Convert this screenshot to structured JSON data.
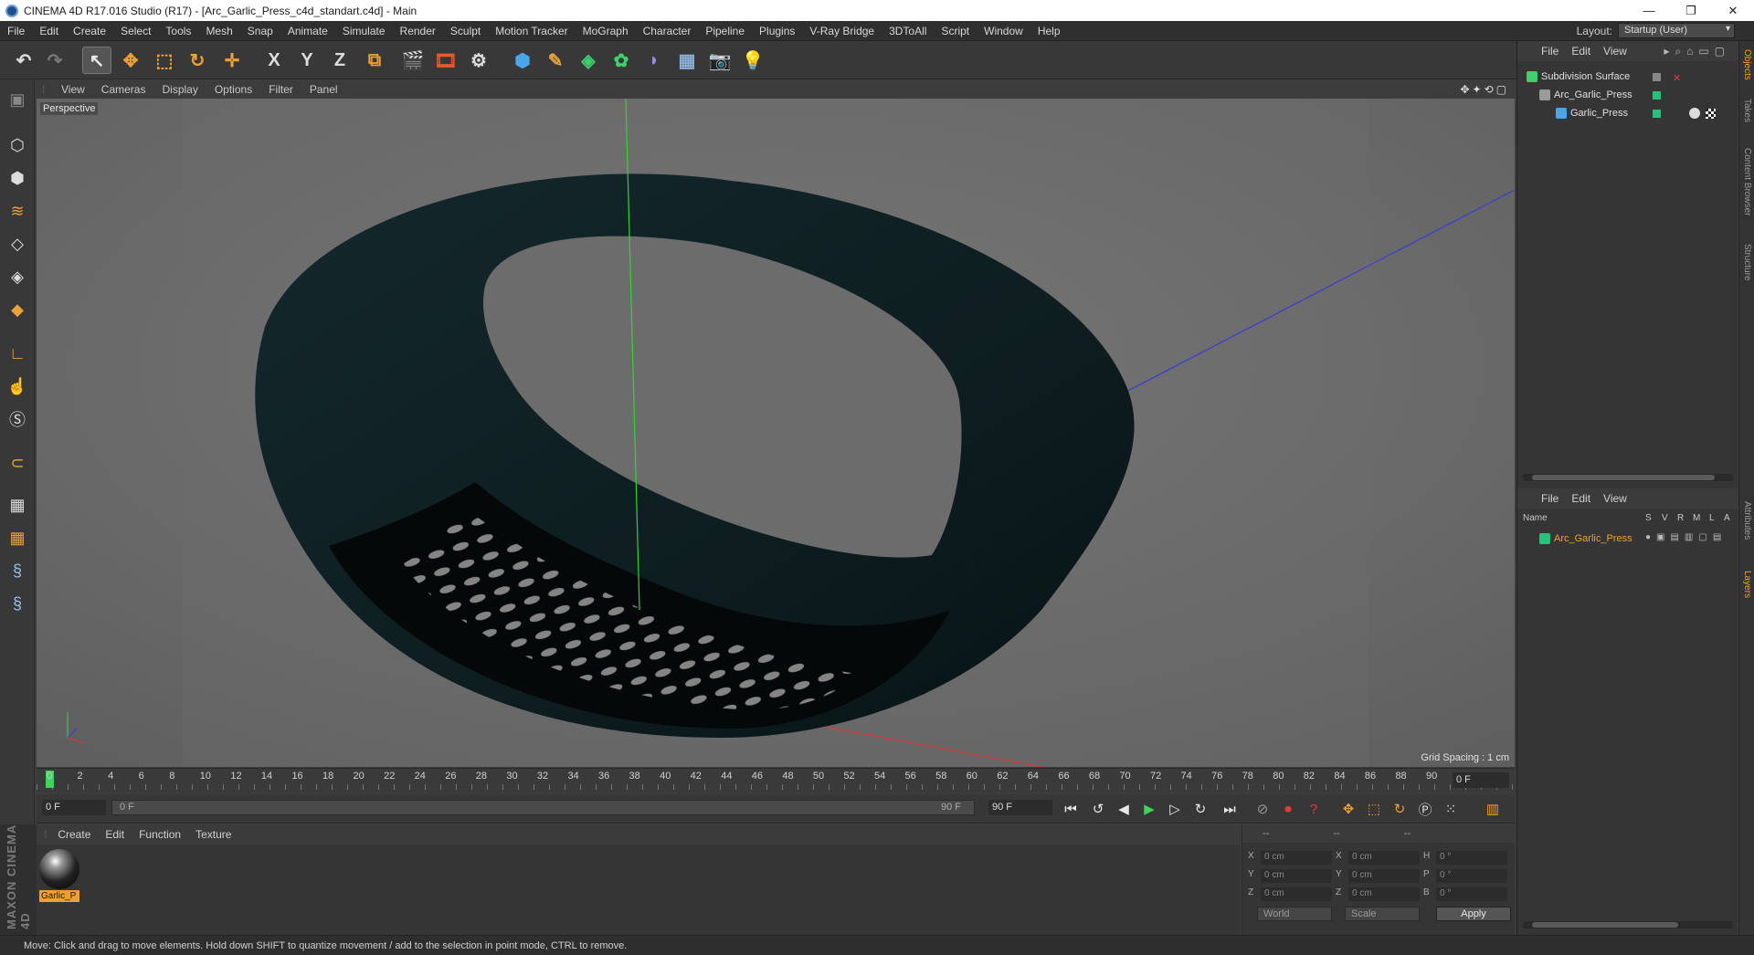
{
  "window": {
    "title": "CINEMA 4D R17.016 Studio (R17) - [Arc_Garlic_Press_c4d_standart.c4d] - Main",
    "controls": [
      "—",
      "❐",
      "✕"
    ]
  },
  "menu": [
    "File",
    "Edit",
    "Create",
    "Select",
    "Tools",
    "Mesh",
    "Snap",
    "Animate",
    "Simulate",
    "Render",
    "Sculpt",
    "Motion Tracker",
    "MoGraph",
    "Character",
    "Pipeline",
    "Plugins",
    "V-Ray Bridge",
    "3DToAll",
    "Script",
    "Window",
    "Help"
  ],
  "layout": {
    "label": "Layout:",
    "value": "Startup (User)"
  },
  "toolbar_icons": [
    "undo-icon",
    "redo-icon",
    "select-arrow-icon",
    "move-icon",
    "scale-icon",
    "rotate-icon",
    "live-select-icon",
    "x-axis-icon",
    "y-axis-icon",
    "z-axis-icon",
    "coordinate-system-icon",
    "render-view-icon",
    "render-picture-viewer-icon",
    "render-settings-icon",
    "cube-icon",
    "pen-icon",
    "subdivision-icon",
    "array-icon",
    "deformer-icon",
    "floor-icon",
    "camera-icon",
    "light-icon"
  ],
  "axis_labels": {
    "x": "X",
    "y": "Y",
    "z": "Z"
  },
  "viewport": {
    "menu": [
      "View",
      "Cameras",
      "Display",
      "Options",
      "Filter",
      "Panel"
    ],
    "label": "Perspective",
    "grid_spacing": "Grid Spacing : 1 cm"
  },
  "timeline": {
    "ticks": [
      "0",
      "2",
      "4",
      "6",
      "8",
      "10",
      "12",
      "14",
      "16",
      "18",
      "20",
      "22",
      "24",
      "26",
      "28",
      "30",
      "32",
      "34",
      "36",
      "38",
      "40",
      "42",
      "44",
      "46",
      "48",
      "50",
      "52",
      "54",
      "56",
      "58",
      "60",
      "62",
      "64",
      "66",
      "68",
      "70",
      "72",
      "74",
      "76",
      "78",
      "80",
      "82",
      "84",
      "86",
      "88",
      "90"
    ],
    "current_frame": "0 F"
  },
  "transport": {
    "start_frame": "0 F",
    "range_start": "0 F",
    "range_end": "90 F",
    "end_frame": "90 F"
  },
  "materials": {
    "menu": [
      "Create",
      "Edit",
      "Function",
      "Texture"
    ],
    "items": [
      {
        "name": "Garlic_P"
      }
    ]
  },
  "coordinates": {
    "headers": [
      "--",
      "--",
      "--"
    ],
    "rows": [
      {
        "a_label": "X",
        "a_val": "0 cm",
        "b_label": "X",
        "b_val": "0 cm",
        "c_label": "H",
        "c_val": "0 °"
      },
      {
        "a_label": "Y",
        "a_val": "0 cm",
        "b_label": "Y",
        "b_val": "0 cm",
        "c_label": "P",
        "c_val": "0 °"
      },
      {
        "a_label": "Z",
        "a_val": "0 cm",
        "b_label": "Z",
        "b_val": "0 cm",
        "c_label": "B",
        "c_val": "0 °"
      }
    ],
    "space": "World",
    "mode": "Scale",
    "apply": "Apply"
  },
  "objects_panel": {
    "menu": [
      "File",
      "Edit",
      "View"
    ],
    "items": [
      "Subdivision Surface",
      "Arc_Garlic_Press",
      "Garlic_Press"
    ]
  },
  "layers_panel": {
    "menu": [
      "File",
      "Edit",
      "View"
    ],
    "columns": [
      "Name",
      "S",
      "V",
      "R",
      "M",
      "L",
      "A"
    ],
    "items": [
      "Arc_Garlic_Press"
    ]
  },
  "side_tabs": [
    "Objects",
    "Takes",
    "Content Browser",
    "Structure",
    "Attributes",
    "Layers"
  ],
  "status": "Move: Click and drag to move elements. Hold down SHIFT to quantize movement / add to the selection in point mode, CTRL to remove.",
  "brand": "MAXON CINEMA 4D",
  "colors": {
    "accent": "#f0a030",
    "playhead": "#3fd35a",
    "layer_green": "#22c47a"
  }
}
